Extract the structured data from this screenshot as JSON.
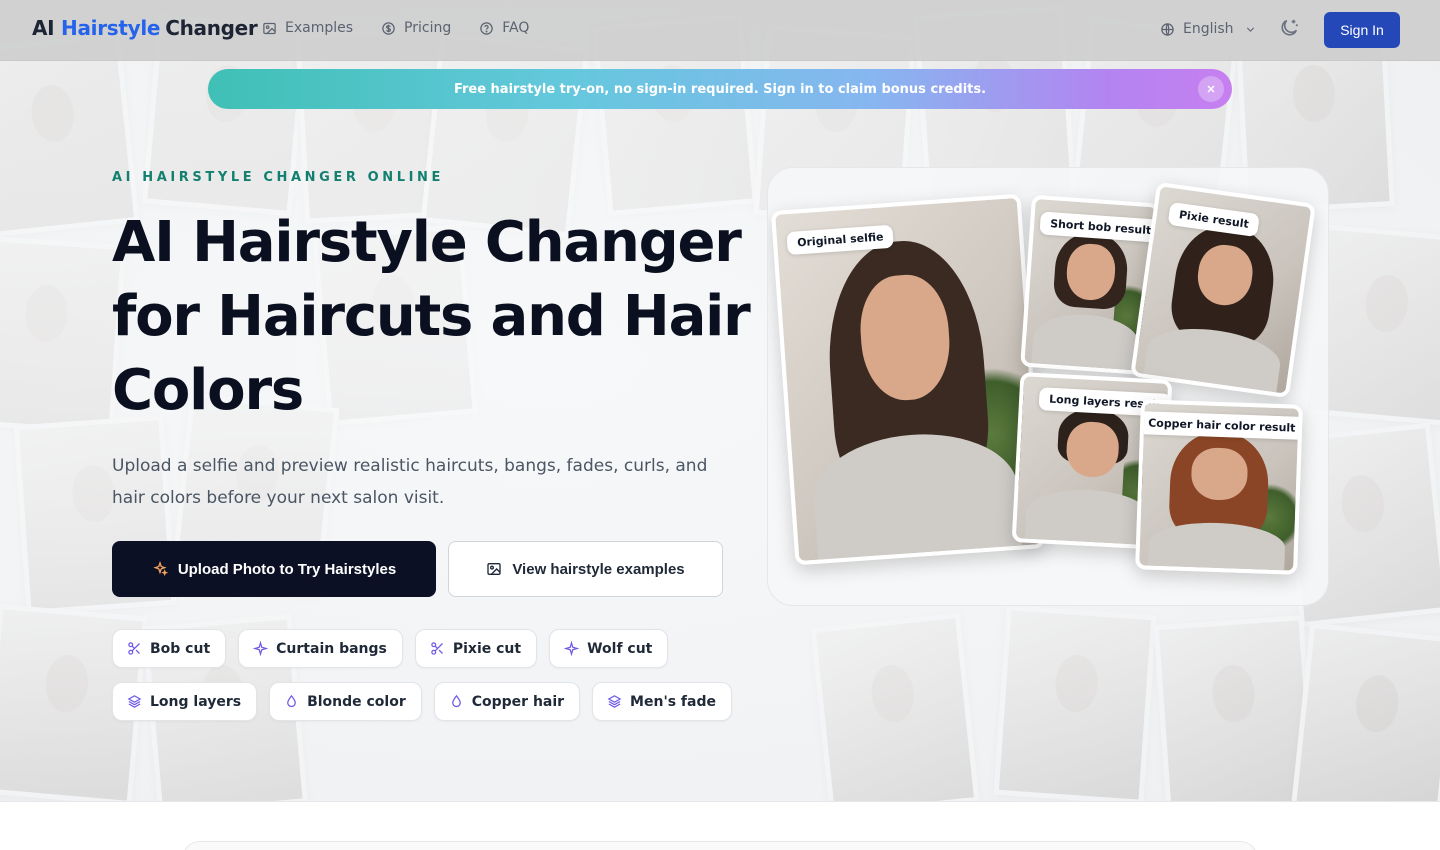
{
  "header": {
    "logo_prefix": "AI",
    "logo_accent": "Hairstyle",
    "logo_suffix": "Changer",
    "nav": [
      {
        "label": "Examples",
        "icon": "image-icon"
      },
      {
        "label": "Pricing",
        "icon": "dollar-circle-icon"
      },
      {
        "label": "FAQ",
        "icon": "help-circle-icon"
      }
    ],
    "language": "English",
    "signin_label": "Sign In"
  },
  "banner": {
    "text": "Free hairstyle try-on, no sign-in required. Sign in to claim bonus credits."
  },
  "hero": {
    "eyebrow": "AI HAIRSTYLE CHANGER ONLINE",
    "title_line1": "AI Hairstyle Changer",
    "title_line2": "for Haircuts and Hair",
    "title_line3": "Colors",
    "subtitle": "Upload a selfie and preview realistic haircuts, bangs, fades, curls, and hair colors before your next salon visit.",
    "cta_primary": "Upload Photo to Try Hairstyles",
    "cta_secondary": "View hairstyle examples",
    "chips_row1": [
      {
        "label": "Bob cut",
        "icon": "scissors-icon"
      },
      {
        "label": "Curtain bangs",
        "icon": "sparkle-icon"
      },
      {
        "label": "Pixie cut",
        "icon": "scissors-icon"
      },
      {
        "label": "Wolf cut",
        "icon": "sparkle-icon"
      }
    ],
    "chips_row2": [
      {
        "label": "Long layers",
        "icon": "layers-icon"
      },
      {
        "label": "Blonde color",
        "icon": "droplet-icon"
      },
      {
        "label": "Copper hair",
        "icon": "droplet-icon"
      },
      {
        "label": "Men's fade",
        "icon": "layers-icon"
      }
    ]
  },
  "preview": {
    "labels": {
      "original": "Original selfie",
      "short_bob": "Short bob result",
      "pixie": "Pixie result",
      "long_layers": "Long layers result",
      "copper": "Copper hair color result"
    }
  },
  "colors": {
    "brand_accent": "#2563eb",
    "signin_bg": "#2548b8",
    "cta_dark": "#0b1024",
    "eyebrow": "#13806f",
    "chip_icon": "#6d5ae6"
  }
}
